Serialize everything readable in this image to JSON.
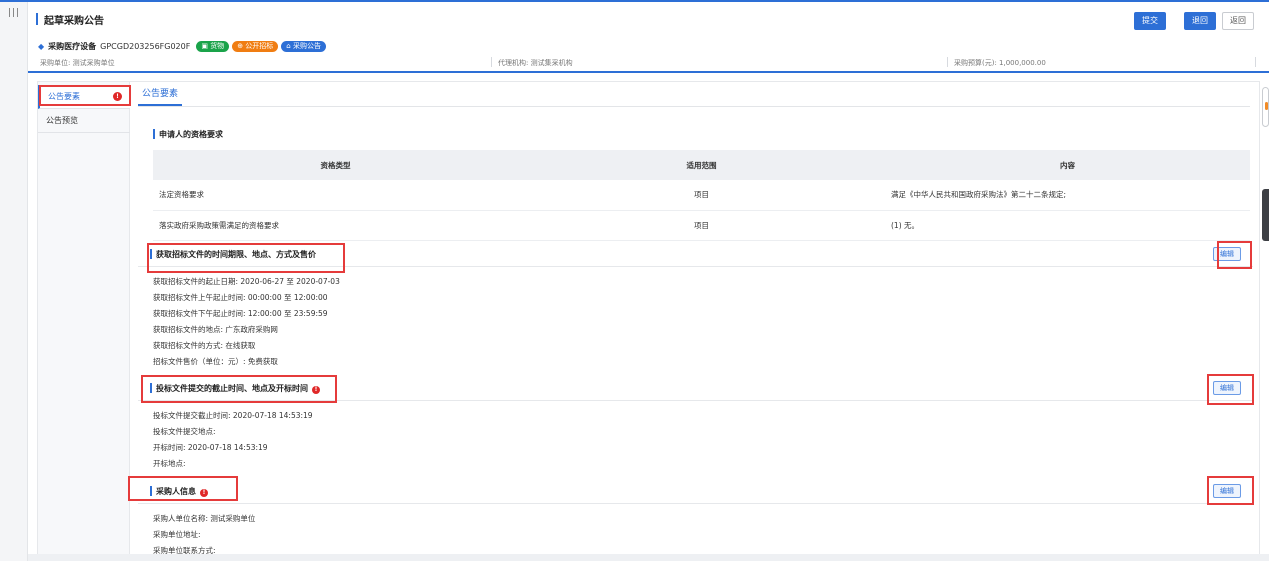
{
  "window": {
    "menu_icon": "|||"
  },
  "header": {
    "title": "起草采购公告",
    "buttons": {
      "submit": "提交",
      "back_primary": "退回",
      "back": "返回"
    },
    "project": {
      "name": "采购医疗设备",
      "code": "GPCGD203256FG020F",
      "tags": [
        {
          "label": "货物",
          "color": "#1aa34a"
        },
        {
          "label": "公开招标",
          "color": "#f07d12"
        },
        {
          "label": "采购公告",
          "color": "#2d6fd6"
        }
      ]
    },
    "meta": {
      "purchaser": "采购单位: 测试采购单位",
      "agency": "代理机构: 测试集采机构",
      "budget": "采购预算(元): 1,000,000.00"
    }
  },
  "sidenav": {
    "items": [
      {
        "label": "公告要素",
        "active": true
      },
      {
        "label": "公告预览",
        "active": false
      }
    ]
  },
  "tab": {
    "label": "公告要素"
  },
  "qualifications": {
    "title": "申请人的资格要求",
    "headers": [
      "资格类型",
      "适用范围",
      "内容"
    ],
    "rows": [
      [
        "法定资格要求",
        "项目",
        "满足《中华人民共和国政府采购法》第二十二条规定;"
      ],
      [
        "落实政府采购政策需满足的资格要求",
        "项目",
        "(1) 无。"
      ]
    ]
  },
  "section_docs": {
    "title": "获取招标文件的时间期限、地点、方式及售价",
    "edit": "编辑",
    "fields": [
      "获取招标文件的起止日期:  2020-06-27 至 2020-07-03",
      "获取招标文件上午起止时间:  00:00:00 至 12:00:00",
      "获取招标文件下午起止时间:  12:00:00 至 23:59:59",
      "获取招标文件的地点:  广东政府采购网",
      "获取招标文件的方式:  在线获取",
      "招标文件售价（单位：元）:  免费获取"
    ]
  },
  "section_bid": {
    "title": "投标文件提交的截止时间、地点及开标时间",
    "edit": "编辑",
    "fields": [
      "投标文件提交截止时间:  2020-07-18 14:53:19",
      "投标文件提交地点:",
      "开标时间:  2020-07-18 14:53:19",
      "开标地点:"
    ]
  },
  "section_buyer": {
    "title": "采购人信息",
    "edit": "编辑",
    "fields": [
      "采购人单位名称:  测试采购单位",
      "采购单位地址:",
      "采购单位联系方式:"
    ]
  },
  "alert_glyph": "!"
}
